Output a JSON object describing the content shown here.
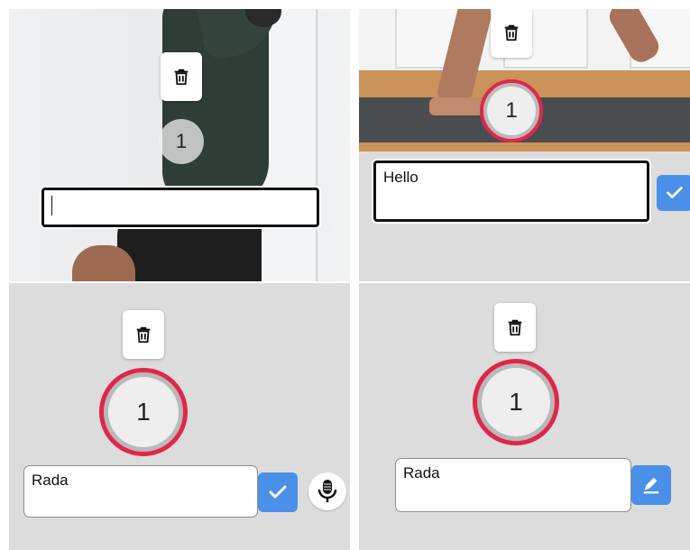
{
  "panels": [
    {
      "marker": "1",
      "input_value": ""
    },
    {
      "marker": "1",
      "input_value": "Hello"
    },
    {
      "marker": "1",
      "input_value": "Rada"
    },
    {
      "marker": "1",
      "input_value": "Rada"
    }
  ],
  "icons": {
    "delete": "trash-icon",
    "confirm": "check-icon",
    "voice": "microphone-icon",
    "edit": "pencil-icon"
  },
  "colors": {
    "marker_ring": "#e0264a",
    "accent_button": "#4a90e8",
    "panel_background": "#dcdcdc"
  }
}
